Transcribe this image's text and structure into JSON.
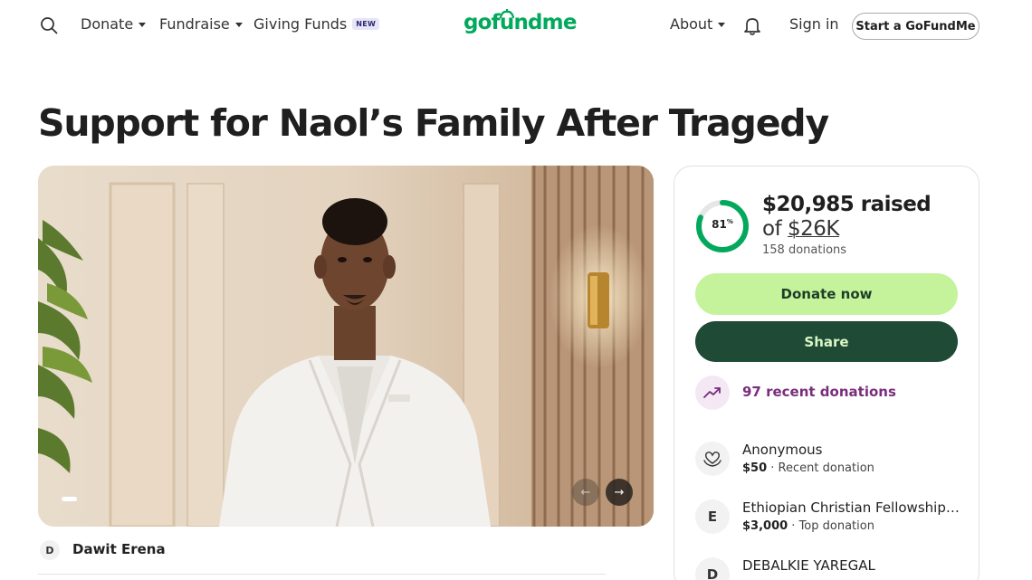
{
  "header": {
    "nav": [
      {
        "label": "Donate",
        "has_caret": true
      },
      {
        "label": "Fundraise",
        "has_caret": true
      },
      {
        "label": "Giving Funds",
        "badge": "NEW"
      }
    ],
    "logo_text": "gofundme",
    "about_label": "About",
    "sign_in_label": "Sign in",
    "start_label": "Start a GoFundMe",
    "icons": {
      "search": "search-icon",
      "notifications": "bell-icon"
    }
  },
  "campaign": {
    "title": "Support for Naol’s Family After Tragedy",
    "organizer": {
      "initial": "D",
      "name": "Dawit Erena"
    },
    "carousel": {
      "prev": "←",
      "next": "→"
    }
  },
  "progress": {
    "percent": 81,
    "percent_label": "81",
    "percent_suffix": "%",
    "raised_label": "$20,985 raised",
    "goal_prefix": "of",
    "goal_amount": "$26K",
    "donations_label": "158 donations"
  },
  "actions": {
    "donate_label": "Donate now",
    "share_label": "Share"
  },
  "recent": {
    "label": "97 recent donations",
    "donors": [
      {
        "initial": "",
        "icon": "heart-hands-icon",
        "name": "Anonymous",
        "amount": "$50",
        "type": "Recent donation"
      },
      {
        "initial": "E",
        "name": "Ethiopian Christian Fellowship…",
        "amount": "$3,000",
        "type": "Top donation"
      },
      {
        "initial": "D",
        "name": "DEBALKIE YAREGAL",
        "amount": "",
        "type": ""
      }
    ]
  },
  "colors": {
    "brand_green": "#02a95c",
    "donate_button": "#c5f39b",
    "share_button": "#1e4a36",
    "recent_accent": "#7a2d7d"
  }
}
